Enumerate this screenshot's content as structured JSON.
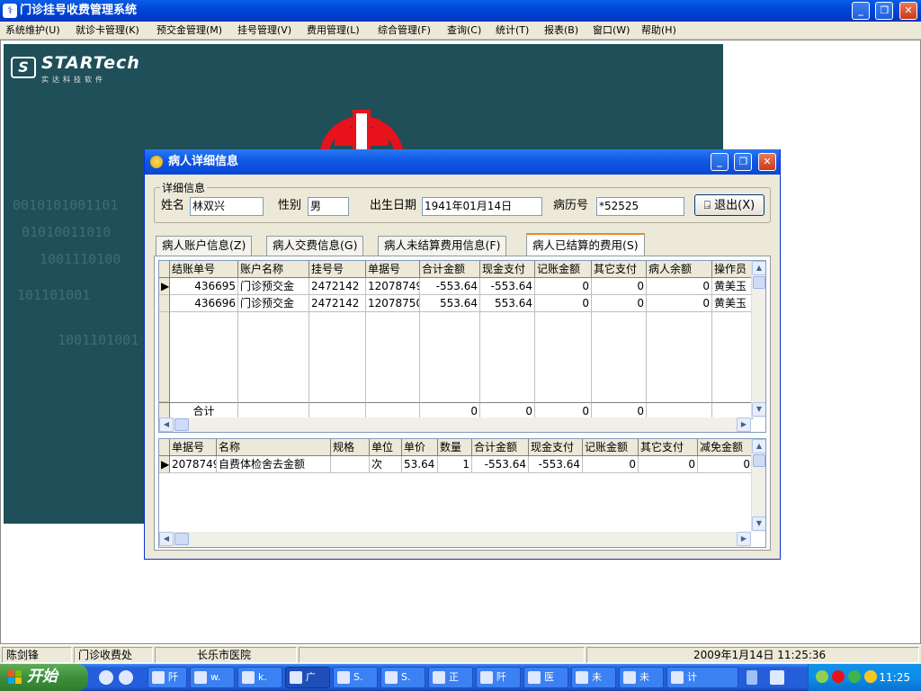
{
  "app": {
    "title": "门诊挂号收费管理系统",
    "win_min": "_",
    "win_restore": "❐",
    "win_close": "✕"
  },
  "menu": [
    "系统维护(U)",
    "就诊卡管理(K)",
    "预交金管理(M)",
    "挂号管理(V)",
    "费用管理(L)",
    "综合管理(F)",
    "查询(C)",
    "统计(T)",
    "报表(B)",
    "窗口(W)",
    "帮助(H)"
  ],
  "brand": {
    "mark": "S",
    "name": "STARTech",
    "subtitle": "实达科技软件"
  },
  "dialog": {
    "title": "病人详细信息",
    "group_label": "详细信息",
    "name_label": "姓名",
    "name_value": "林双兴",
    "sex_label": "性别",
    "sex_value": "男",
    "birth_label": "出生日期",
    "birth_value": "1941年01月14日",
    "record_label": "病历号",
    "record_value": "*52525",
    "exit_label": "退出(X)",
    "tabs": [
      "病人账户信息(Z)",
      "病人交费信息(G)",
      "病人未结算费用信息(F)",
      "病人已结算的费用(S)"
    ],
    "active_tab": 3
  },
  "settlement_table": {
    "headers": [
      "结账单号",
      "账户名称",
      "挂号号",
      "单据号",
      "合计金额",
      "现金支付",
      "记账金额",
      "其它支付",
      "病人余额",
      "操作员"
    ],
    "rows": [
      [
        "436695",
        "门诊预交金",
        "2472142",
        "12078749",
        "-553.64",
        "-553.64",
        "0",
        "0",
        "0",
        "黄美玉"
      ],
      [
        "436696",
        "门诊预交金",
        "2472142",
        "12078750",
        "553.64",
        "553.64",
        "0",
        "0",
        "0",
        "黄美玉"
      ]
    ],
    "total_label": "合计",
    "totals": [
      "0",
      "0",
      "0",
      "0"
    ]
  },
  "detail_table": {
    "headers": [
      "单据号",
      "名称",
      "规格",
      "单位",
      "单价",
      "数量",
      "合计金额",
      "现金支付",
      "记账金额",
      "其它支付",
      "减免金额"
    ],
    "rows": [
      [
        "2078749",
        "自费体检舍去金额",
        "",
        "次",
        "53.64",
        "1",
        "-553.64",
        "-553.64",
        "0",
        "0",
        "0"
      ]
    ]
  },
  "statusbar": {
    "user": "陈剑锋",
    "dept": "门诊收费处",
    "hospital": "长乐市医院",
    "datetime": "2009年1月14日  11:25:36"
  },
  "taskbar": {
    "start": "开始",
    "items": [
      "阡",
      "w.",
      "k.",
      "广",
      "S.",
      "S.",
      "正",
      "阡",
      "医",
      "未",
      "未",
      "计"
    ],
    "clock": "11:25"
  },
  "colors": {
    "xp_blue": "#0a47d2",
    "teal_bg": "#1f4f58",
    "red_cross": "#e8121b",
    "dialog_bg": "#ece9d8"
  }
}
